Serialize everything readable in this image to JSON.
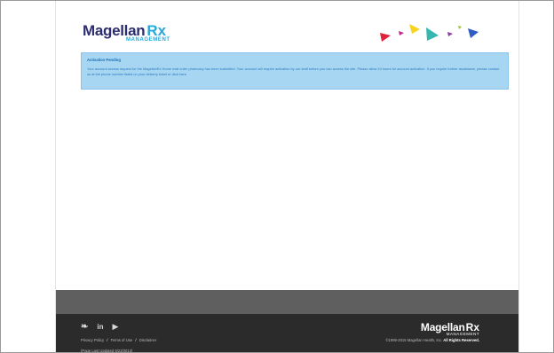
{
  "header": {
    "logo_main": "Magellan",
    "logo_rx": "Rx",
    "logo_sub": "MANAGEMENT",
    "colors": {
      "navy": "#2b2d6e",
      "cyan": "#27a8d8"
    }
  },
  "notice": {
    "title": "Activation Pending",
    "text": "Your account access request for the MagellanRx Home mail order pharmacy has been submitted. Your account will require activation by our staff before you can access the site. Please allow 24 hours for account activation. If you require further assistance, please contact us at the phone number listed on your delivery ticket or click here"
  },
  "footer": {
    "social": {
      "twitter": "twitter-icon",
      "linkedin": "linkedin-icon",
      "youtube": "youtube-icon"
    },
    "twitter_glyph": "❧",
    "linkedin_glyph": "in",
    "youtube_glyph": "▶",
    "privacy": "Privacy Policy",
    "terms": "Terms of Use",
    "disclaimer": "Disclaimer",
    "updated": "(Page Last Updated 9/23/2013)",
    "logo_main": "Magellan",
    "logo_rx": "Rx",
    "logo_sub": "MANAGEMENT",
    "copyright_prefix": "©1999-2015 Magellan Health, Inc.",
    "copyright_bold": "All Rights Reserved."
  }
}
